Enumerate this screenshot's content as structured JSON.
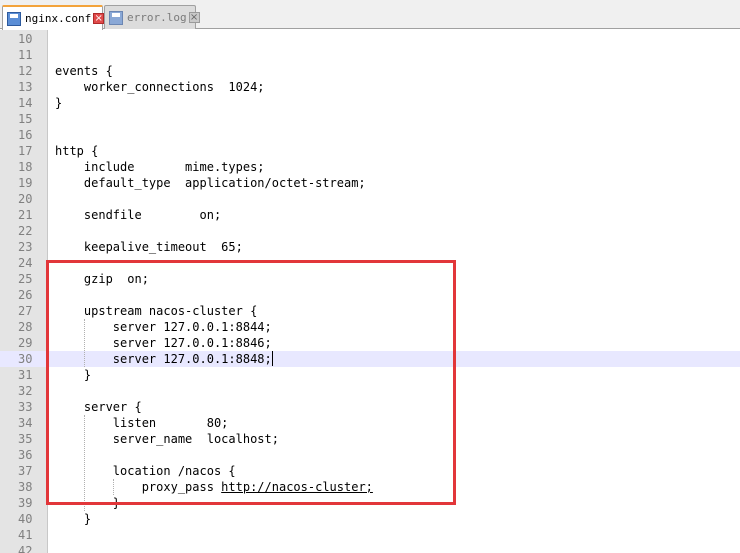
{
  "tabs": [
    {
      "label": "nginx.conf",
      "active": true,
      "icon": "file-icon"
    },
    {
      "label": "error.log",
      "active": false,
      "icon": "file-icon"
    }
  ],
  "tab_close_glyph": "×",
  "editor": {
    "current_line": 30,
    "lines": [
      {
        "num": "10",
        "text": ""
      },
      {
        "num": "11",
        "text": ""
      },
      {
        "num": "12",
        "text": "events {"
      },
      {
        "num": "13",
        "text": "    worker_connections  1024;"
      },
      {
        "num": "14",
        "text": "}"
      },
      {
        "num": "15",
        "text": ""
      },
      {
        "num": "16",
        "text": ""
      },
      {
        "num": "17",
        "text": "http {"
      },
      {
        "num": "18",
        "text": "    include       mime.types;"
      },
      {
        "num": "19",
        "text": "    default_type  application/octet-stream;"
      },
      {
        "num": "20",
        "text": ""
      },
      {
        "num": "21",
        "text": "    sendfile        on;"
      },
      {
        "num": "22",
        "text": ""
      },
      {
        "num": "23",
        "text": "    keepalive_timeout  65;"
      },
      {
        "num": "24",
        "text": ""
      },
      {
        "num": "25",
        "text": "    gzip  on;"
      },
      {
        "num": "26",
        "text": ""
      },
      {
        "num": "27",
        "text": "    upstream nacos-cluster {"
      },
      {
        "num": "28",
        "text": "        server 127.0.0.1:8844;"
      },
      {
        "num": "29",
        "text": "        server 127.0.0.1:8846;"
      },
      {
        "num": "30",
        "text": "        server 127.0.0.1:8848;"
      },
      {
        "num": "31",
        "text": "    }"
      },
      {
        "num": "32",
        "text": ""
      },
      {
        "num": "33",
        "text": "    server {"
      },
      {
        "num": "34",
        "text": "        listen       80;"
      },
      {
        "num": "35",
        "text": "        server_name  localhost;"
      },
      {
        "num": "36",
        "text": ""
      },
      {
        "num": "37",
        "text": "        location /nacos {"
      },
      {
        "num": "38",
        "text": "            proxy_pass ",
        "url": "http://nacos-cluster;"
      },
      {
        "num": "39",
        "text": "        }"
      },
      {
        "num": "40",
        "text": "    }"
      },
      {
        "num": "41",
        "text": ""
      },
      {
        "num": "42",
        "text": ""
      }
    ]
  },
  "colors": {
    "highlight_box": "#e2363a",
    "current_line": "#e8e8ff",
    "active_tab_accent": "#f3a33b"
  }
}
